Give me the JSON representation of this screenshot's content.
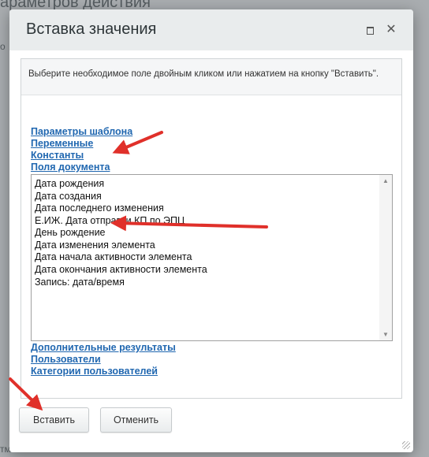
{
  "background": {
    "title_fragment": "араметров действия",
    "left_fragment": "о",
    "bottom_fragment": "тменить"
  },
  "dialog": {
    "title": "Вставка значения",
    "info_text": "Выберите необходимое поле двойным кликом или нажатием на кнопку \"Вставить\".",
    "links_top": [
      "Параметры шаблона",
      "Переменные",
      "Константы",
      "Поля документа"
    ],
    "list_items": [
      "Дата рождения",
      "Дата создания",
      "Дата последнего изменения",
      "Е.ИЖ. Дата отправки КП по ЭПЦ",
      "День рождение",
      "Дата изменения элемента",
      "Дата начала активности элемента",
      "Дата окончания активности элемента",
      "Запись: дата/время"
    ],
    "links_bottom": [
      "Дополнительные результаты",
      "Пользователи",
      "Категории пользователей"
    ],
    "buttons": {
      "insert": "Вставить",
      "cancel": "Отменить"
    }
  },
  "colors": {
    "link": "#2067b0",
    "arrow": "#e0302a",
    "header_bg": "#e9eced"
  }
}
